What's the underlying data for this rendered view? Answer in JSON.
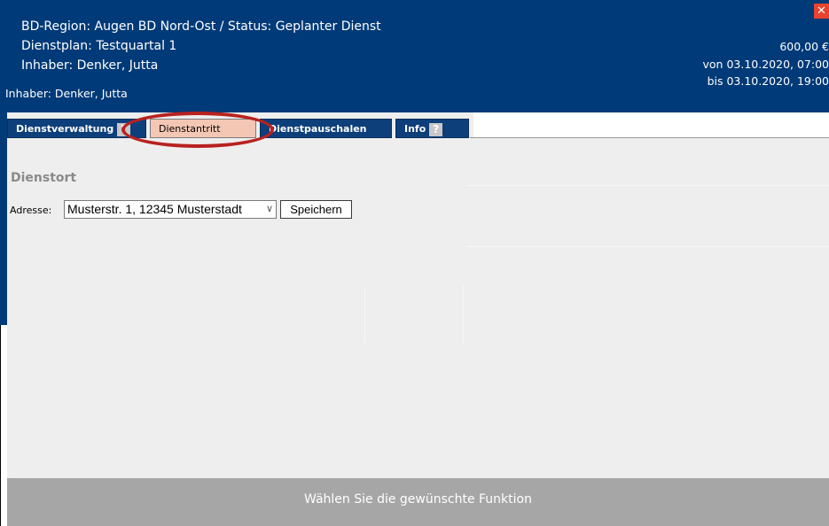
{
  "header": {
    "line1": "BD-Region: Augen BD Nord-Ost / Status: Geplanter Dienst",
    "line2": "Dienstplan: Testquartal 1",
    "line3": "Inhaber: Denker, Jutta",
    "owner_small": "Inhaber: Denker, Jutta",
    "amount": "600,00 €",
    "from": "von 03.10.2020, 07:00",
    "to": "bis 03.10.2020, 19:00",
    "close_glyph": "✕"
  },
  "tabs": [
    {
      "label": "Dienstverwaltung",
      "help": "?",
      "active": false
    },
    {
      "label": "Dienstantritt",
      "active": true
    },
    {
      "label": "Dienstpauschalen",
      "active": false
    },
    {
      "label": "Info",
      "help": "?",
      "active": false
    }
  ],
  "section": {
    "title": "Dienstort"
  },
  "form": {
    "address_label": "Adresse:",
    "address_value": "Musterstr. 1, 12345 Musterstadt",
    "save_label": "Speichern"
  },
  "footer": {
    "text": "Wählen Sie die gewünschte Funktion"
  },
  "colors": {
    "header_bg": "#003a78",
    "active_tab": "#f4c7b5",
    "highlight": "#b8221f",
    "footer_bg": "#a6a6a6"
  }
}
